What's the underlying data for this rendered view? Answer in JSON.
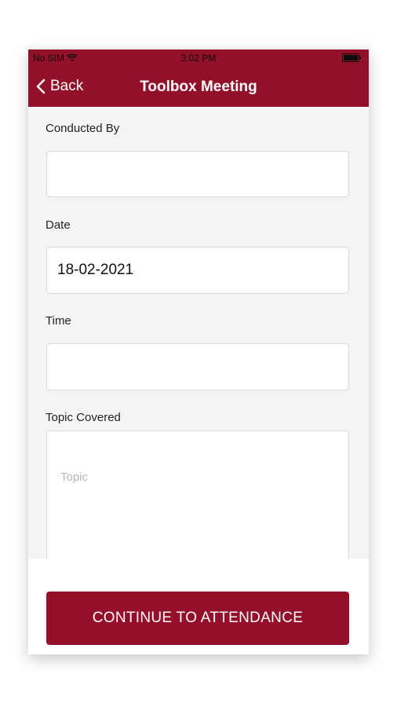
{
  "status_bar": {
    "carrier": "No SIM",
    "time": "3:02 PM"
  },
  "nav": {
    "back_label": "Back",
    "title": "Toolbox Meeting"
  },
  "form": {
    "conducted_by": {
      "label": "Conducted By",
      "value": ""
    },
    "date": {
      "label": "Date",
      "value": "18-02-2021"
    },
    "time": {
      "label": "Time",
      "value": ""
    },
    "topic": {
      "label": "Topic Covered",
      "placeholder": "Topic",
      "value": ""
    }
  },
  "footer": {
    "continue_label": "CONTINUE TO ATTENDANCE"
  },
  "colors": {
    "brand": "#92102a",
    "background": "#f4f4f4"
  },
  "icons": {
    "wifi": "wifi-icon",
    "battery": "battery-icon",
    "back": "chevron-left-icon"
  }
}
